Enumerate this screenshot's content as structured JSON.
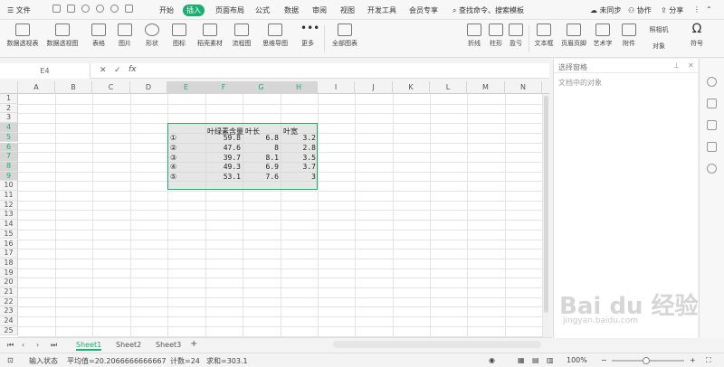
{
  "menubar": {
    "file": "文件",
    "tabs": [
      "开始",
      "插入",
      "页面布局",
      "公式",
      "数据",
      "审阅",
      "视图",
      "开发工具",
      "会员专享"
    ],
    "active_tab": "插入",
    "search_placeholder": "查找命令、搜索模板",
    "unsync": "未同步",
    "collab": "协作",
    "share": "分享"
  },
  "ribbon": {
    "items": [
      "数据透视表",
      "数据透视图",
      "表格",
      "图片",
      "形状",
      "图标",
      "稻壳素材",
      "流程图",
      "思维导图",
      "更多",
      "全部图表",
      "折线",
      "柱形",
      "盈亏",
      "文本框",
      "页眉页脚",
      "艺术字",
      "附件",
      "对象",
      "照相机",
      "符号"
    ]
  },
  "formula": {
    "cell_ref": "E4",
    "cancel": "✕",
    "confirm": "✓",
    "fx": "fx"
  },
  "grid": {
    "columns": [
      "A",
      "B",
      "C",
      "D",
      "E",
      "F",
      "G",
      "H",
      "I",
      "J",
      "K",
      "L",
      "M",
      "N"
    ],
    "rows": [
      "1",
      "2",
      "3",
      "4",
      "5",
      "6",
      "7",
      "8",
      "9",
      "10",
      "11",
      "12",
      "13",
      "14",
      "15",
      "16",
      "17",
      "18",
      "19",
      "20",
      "21",
      "22",
      "23",
      "24",
      "25"
    ],
    "header": {
      "F": "叶绿素含量",
      "G": "叶长",
      "H": "叶宽"
    },
    "data": [
      [
        "①",
        "59.8",
        "6.8",
        "3.2"
      ],
      [
        "②",
        "47.6",
        "8",
        "2.8"
      ],
      [
        "③",
        "39.7",
        "8.1",
        "3.5"
      ],
      [
        "④",
        "49.3",
        "6.9",
        "3.7"
      ],
      [
        "⑤",
        "53.1",
        "7.6",
        "3"
      ]
    ]
  },
  "panel": {
    "title": "选择窗格",
    "subtitle": "文档中的对象"
  },
  "sheets": [
    "Sheet1",
    "Sheet2",
    "Sheet3"
  ],
  "status": {
    "mode": "输入状态",
    "avg": "平均值=20.2066666666667",
    "count": "计数=24",
    "sum": "求和=303.1",
    "zoom": "100%"
  },
  "watermark": {
    "main": "Bai du 经验",
    "sub": "jingyan.baidu.com"
  }
}
